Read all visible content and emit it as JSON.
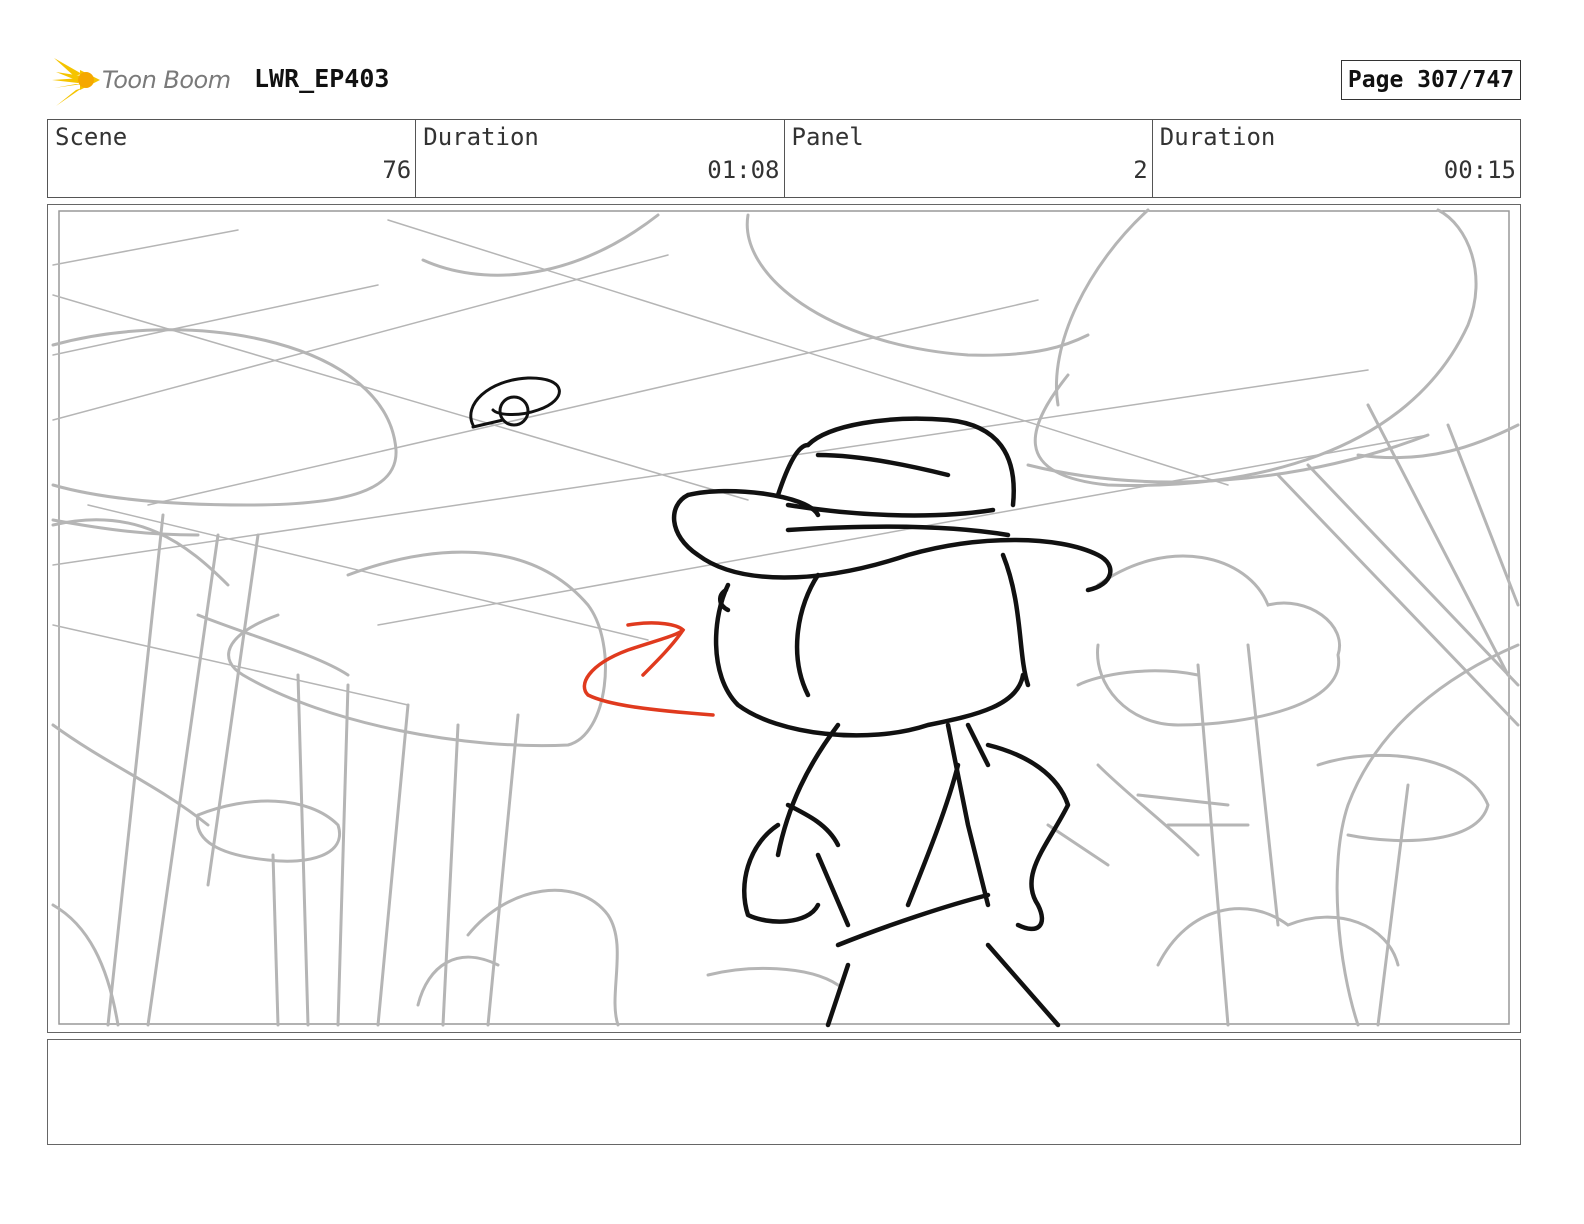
{
  "header": {
    "logo_text": "Toon Boom",
    "project": "LWR_EP403",
    "page": "Page 307/747"
  },
  "meta": {
    "scene_label": "Scene",
    "scene_value": "76",
    "scene_duration_label": "Duration",
    "scene_duration_value": "01:08",
    "panel_label": "Panel",
    "panel_value": "2",
    "panel_duration_label": "Duration",
    "panel_duration_value": "00:15"
  },
  "colors": {
    "sketch_gray": "#b5b5b5",
    "ink_black": "#111111",
    "arrow_red": "#e03a1e",
    "logo_yellow": "#f5c400"
  },
  "notes": ""
}
